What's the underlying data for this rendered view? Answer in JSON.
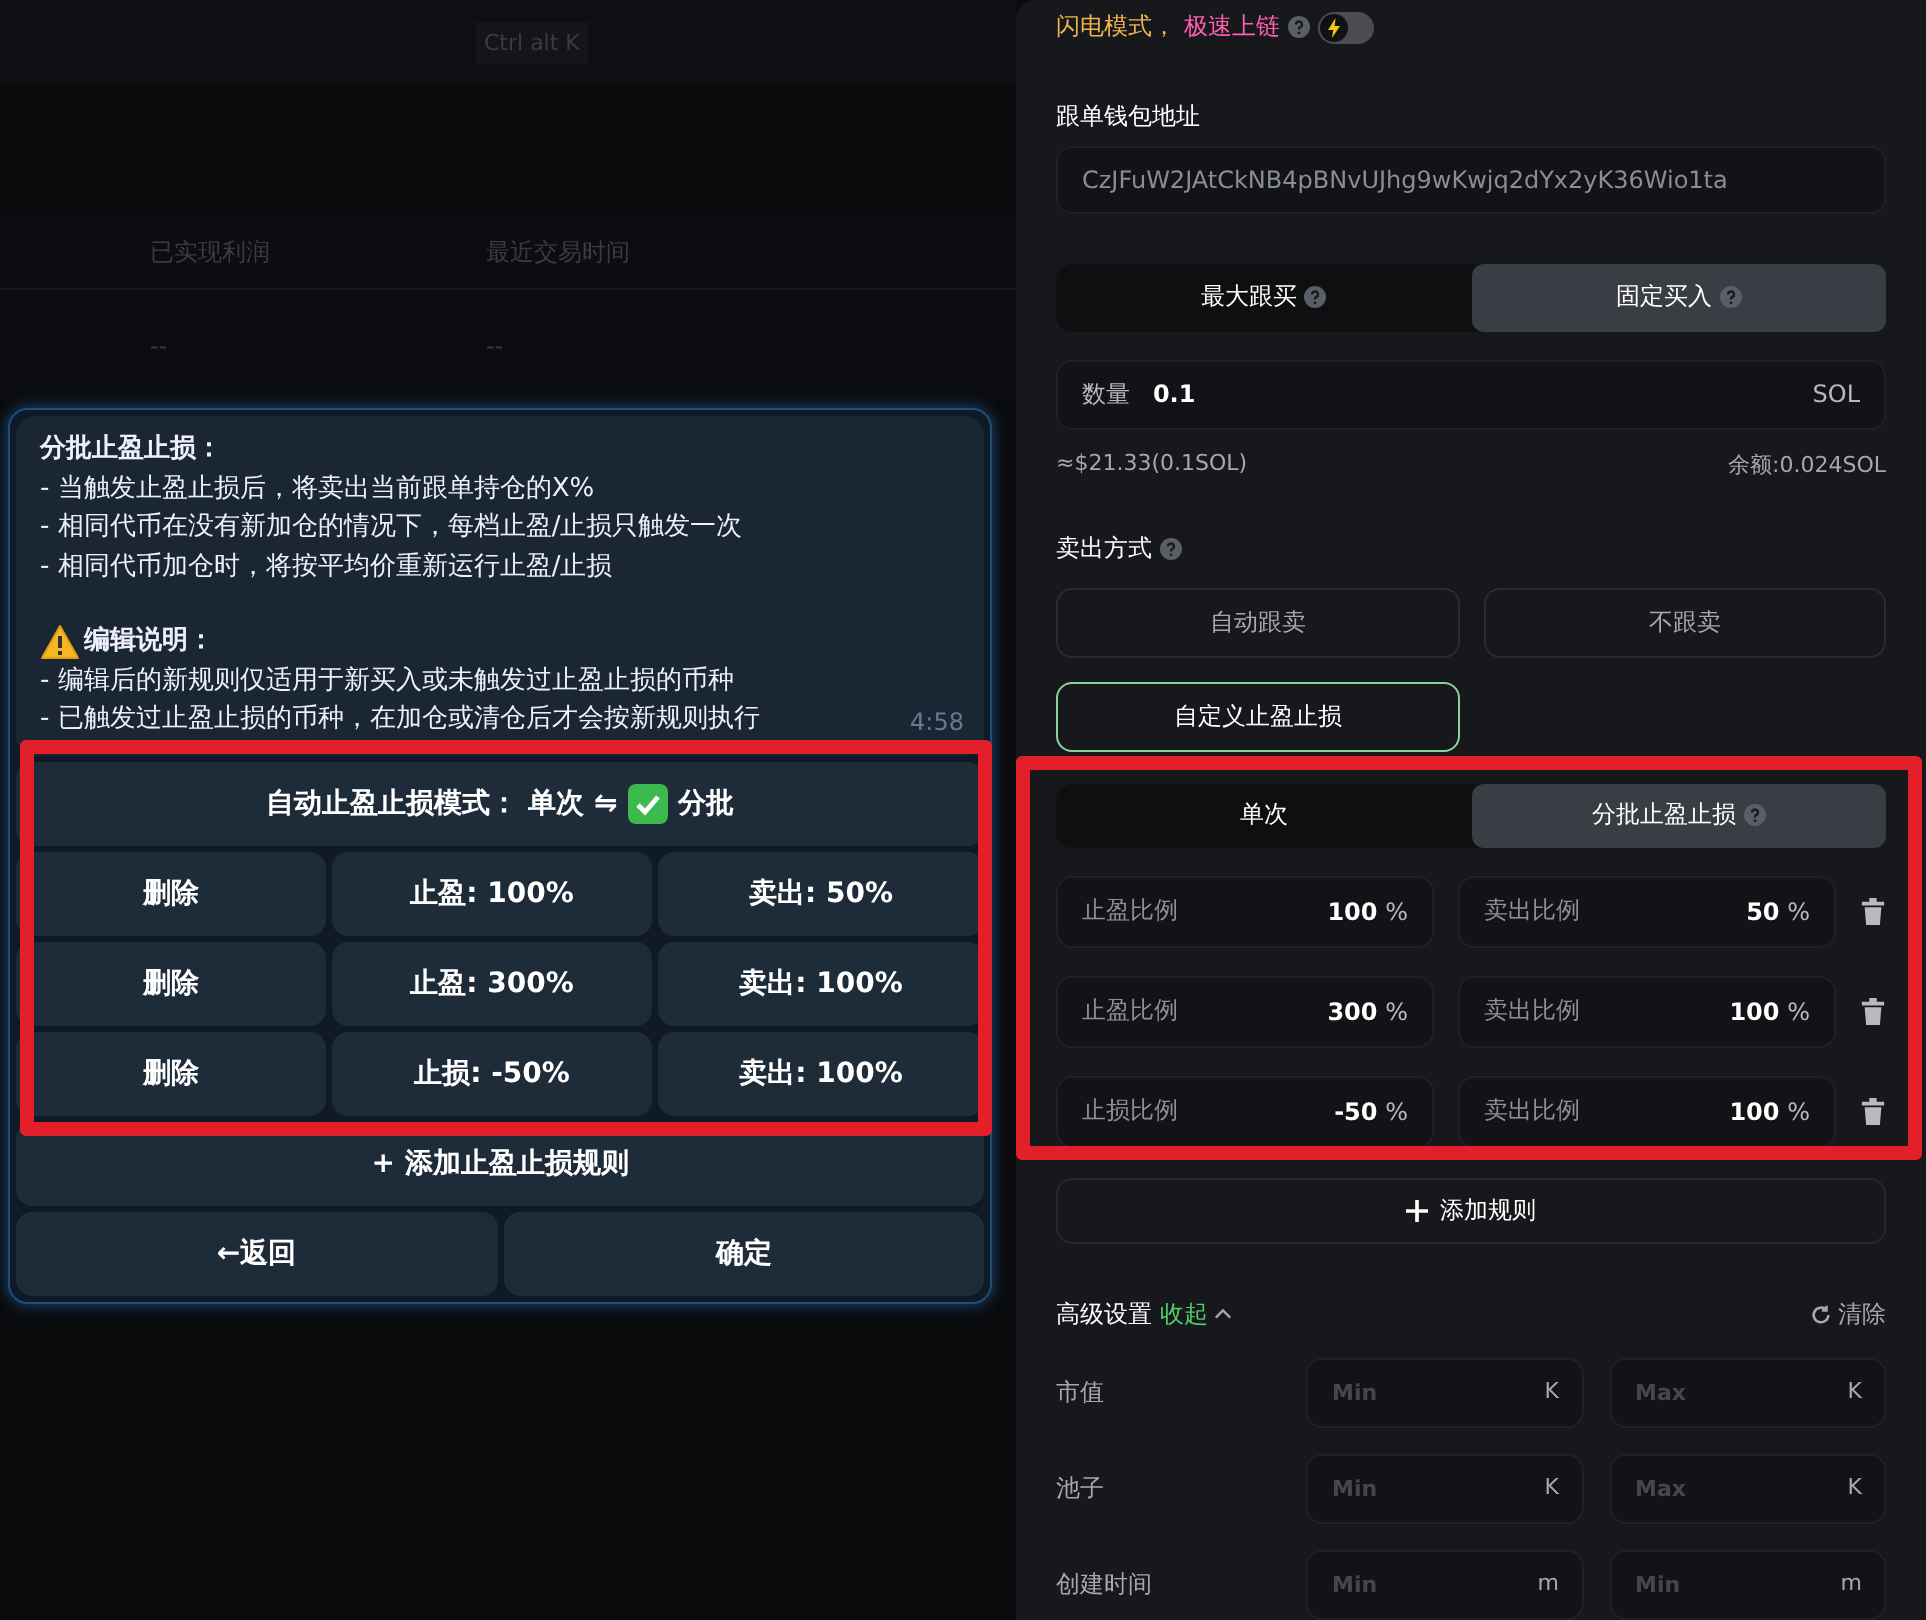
{
  "background": {
    "shortcut": "Ctrl alt K",
    "columns": [
      "已实现利润",
      "最近交易时间"
    ],
    "row": [
      "--",
      "--"
    ]
  },
  "bot_message": {
    "title": "分批止盈止损：",
    "lines": [
      "- 当触发止盈止损后，将卖出当前跟单持仓的X%",
      "- 相同代币在没有新加仓的情况下，每档止盈/止损只触发一次",
      "- 相同代币加仓时，将按平均价重新运行止盈/止损"
    ],
    "note_title": "编辑说明：",
    "note_lines": [
      "- 编辑后的新规则仅适用于新买入或未触发过止盈止损的币种",
      "- 已触发过止盈止损的币种，在加仓或清仓后才会按新规则执行"
    ],
    "time": "4:58"
  },
  "keyboard": {
    "mode": {
      "label": "自动止盈止损模式：",
      "first": "单次 ⇋",
      "second": "分批",
      "checked": true
    },
    "rows": [
      [
        "删除",
        "止盈: 100%",
        "卖出: 50%"
      ],
      [
        "删除",
        "止盈: 300%",
        "卖出: 100%"
      ],
      [
        "删除",
        "止损: -50%",
        "卖出: 100%"
      ]
    ],
    "add": "+ 添加止盈止损规则",
    "back": "←返回",
    "confirm": "确定"
  },
  "panel": {
    "lightning": {
      "text": "闪电模式，",
      "highlight": "极速上链",
      "on": false
    },
    "wallet": {
      "label": "跟单钱包地址",
      "value": "CzJFuW2JAtCkNB4pBNvUJhg9wKwjq2dYx2yK36Wio1ta"
    },
    "buy_tabs": [
      {
        "label": "最大跟买",
        "selected": false
      },
      {
        "label": "固定买入",
        "selected": true
      }
    ],
    "amount": {
      "label": "数量",
      "value": "0.1",
      "unit": "SOL"
    },
    "estimate": "≈$21.33(0.1SOL)",
    "balance": "余额:0.024SOL",
    "sell_label": "卖出方式",
    "sell_modes": [
      {
        "label": "自动跟卖",
        "selected": false
      },
      {
        "label": "不跟卖",
        "selected": false
      },
      {
        "label": "自定义止盈止损",
        "selected": true
      }
    ],
    "tp_tabs": [
      {
        "label": "单次",
        "selected": false,
        "help": false
      },
      {
        "label": "分批止盈止损",
        "selected": true,
        "help": true
      }
    ],
    "rules": [
      [
        {
          "label": "止盈比例",
          "value": "100",
          "unit": "%"
        },
        {
          "label": "卖出比例",
          "value": "50",
          "unit": "%"
        }
      ],
      [
        {
          "label": "止盈比例",
          "value": "300",
          "unit": "%"
        },
        {
          "label": "卖出比例",
          "value": "100",
          "unit": "%"
        }
      ],
      [
        {
          "label": "止损比例",
          "value": "-50",
          "unit": "%"
        },
        {
          "label": "卖出比例",
          "value": "100",
          "unit": "%"
        }
      ]
    ],
    "add_rule": "添加规则",
    "advanced": {
      "label": "高级设置",
      "toggle": "收起",
      "clear": "清除",
      "rows": [
        {
          "label": "市值",
          "fields": [
            {
              "placeholder": "Min",
              "unit": "K"
            },
            {
              "placeholder": "Max",
              "unit": "K"
            }
          ]
        },
        {
          "label": "池子",
          "fields": [
            {
              "placeholder": "Min",
              "unit": "K"
            },
            {
              "placeholder": "Max",
              "unit": "K"
            }
          ]
        },
        {
          "label": "创建时间",
          "fields": [
            {
              "placeholder": "Min",
              "unit": "m"
            },
            {
              "placeholder": "Min",
              "unit": "m"
            }
          ]
        }
      ]
    }
  }
}
